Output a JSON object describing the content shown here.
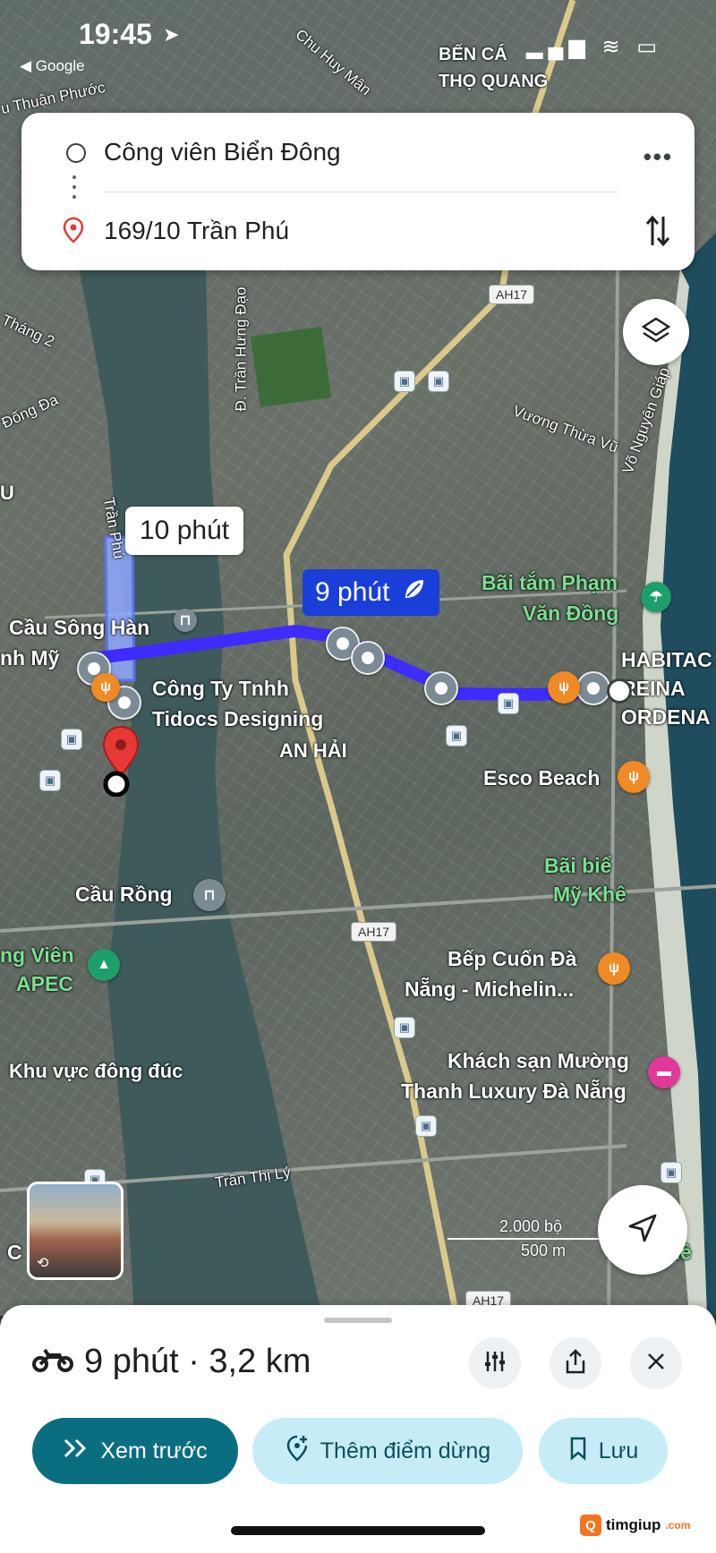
{
  "status_bar": {
    "time": "19:45",
    "back_label": "◀ Google",
    "sys_icons": "▂▄▆ ≋ ▭"
  },
  "directions": {
    "origin": "Công viên Biển Đông",
    "destination": "169/10 Trần Phú"
  },
  "map": {
    "top_labels": {
      "ben_ca": "BẾN CÁ",
      "tho_quang": "THỌ QUANG",
      "chu_huy_man": "Chu Huy Mân",
      "tu_thuan_phuoc": "u Thuận Phước"
    },
    "roads": {
      "thang2": "Tháng 2",
      "dong_da": "Đống Đa",
      "tran_hung_dao": "Đ. Trần Hưng Đạo",
      "vuong_thua_vu": "Vương Thừa Vũ",
      "vo_nguyen_giap": "Võ Nguyên Giáp",
      "tran_phu": "Trần Phú",
      "tran_thi_ly": "Trần Thị Lý",
      "u": "U",
      "nh_my": "nh Mỹ"
    },
    "shields": {
      "ah17_top": "AH17",
      "ah17_mid": "AH17",
      "ah17_bottom": "AH17"
    },
    "pois": {
      "cau_song_han": "Cầu Sông Hàn",
      "cong_ty_line1": "Công Ty Tnhh",
      "cong_ty_line2": "Tidocs Designing",
      "an_hai": "AN HẢI",
      "bai_tam_line1": "Bãi tắm Phạm",
      "bai_tam_line2": "Văn Đồng",
      "habitac_line1": "HABITAC",
      "habitac_line2": "REINA",
      "habitac_line3": "ORDENA",
      "esco_beach": "Esco Beach",
      "bai_bien_line1": "Bãi biể",
      "bai_bien_line2": "Mỹ Khê",
      "cau_rong": "Cầu Rồng",
      "cv_apec_line1": "ng Viên",
      "cv_apec_line2": "APEC",
      "bep_cuon_line1": "Bếp Cuốn Đà",
      "bep_cuon_line2": "Nẵng - Michelin...",
      "khu_vuc": "Khu vực đông đúc",
      "khach_san_line1": "Khách sạn Mường",
      "khach_san_line2": "Thanh Luxury Đà Nẵng",
      "c": "C",
      "he": "hê"
    },
    "callouts": {
      "alt_route": "10 phút",
      "main_route": "9 phút"
    },
    "scale": {
      "feet": "2.000 bộ",
      "meters": "500 m"
    },
    "route_color": "#3d2bff"
  },
  "sheet": {
    "summary": "9 phút · 3,2 km",
    "buttons": {
      "preview": "Xem trước",
      "add_stop": "Thêm điểm dừng",
      "save": "Lưu"
    }
  },
  "watermark": {
    "logo": "Q",
    "text": "timgiup",
    "suffix": ".com"
  }
}
